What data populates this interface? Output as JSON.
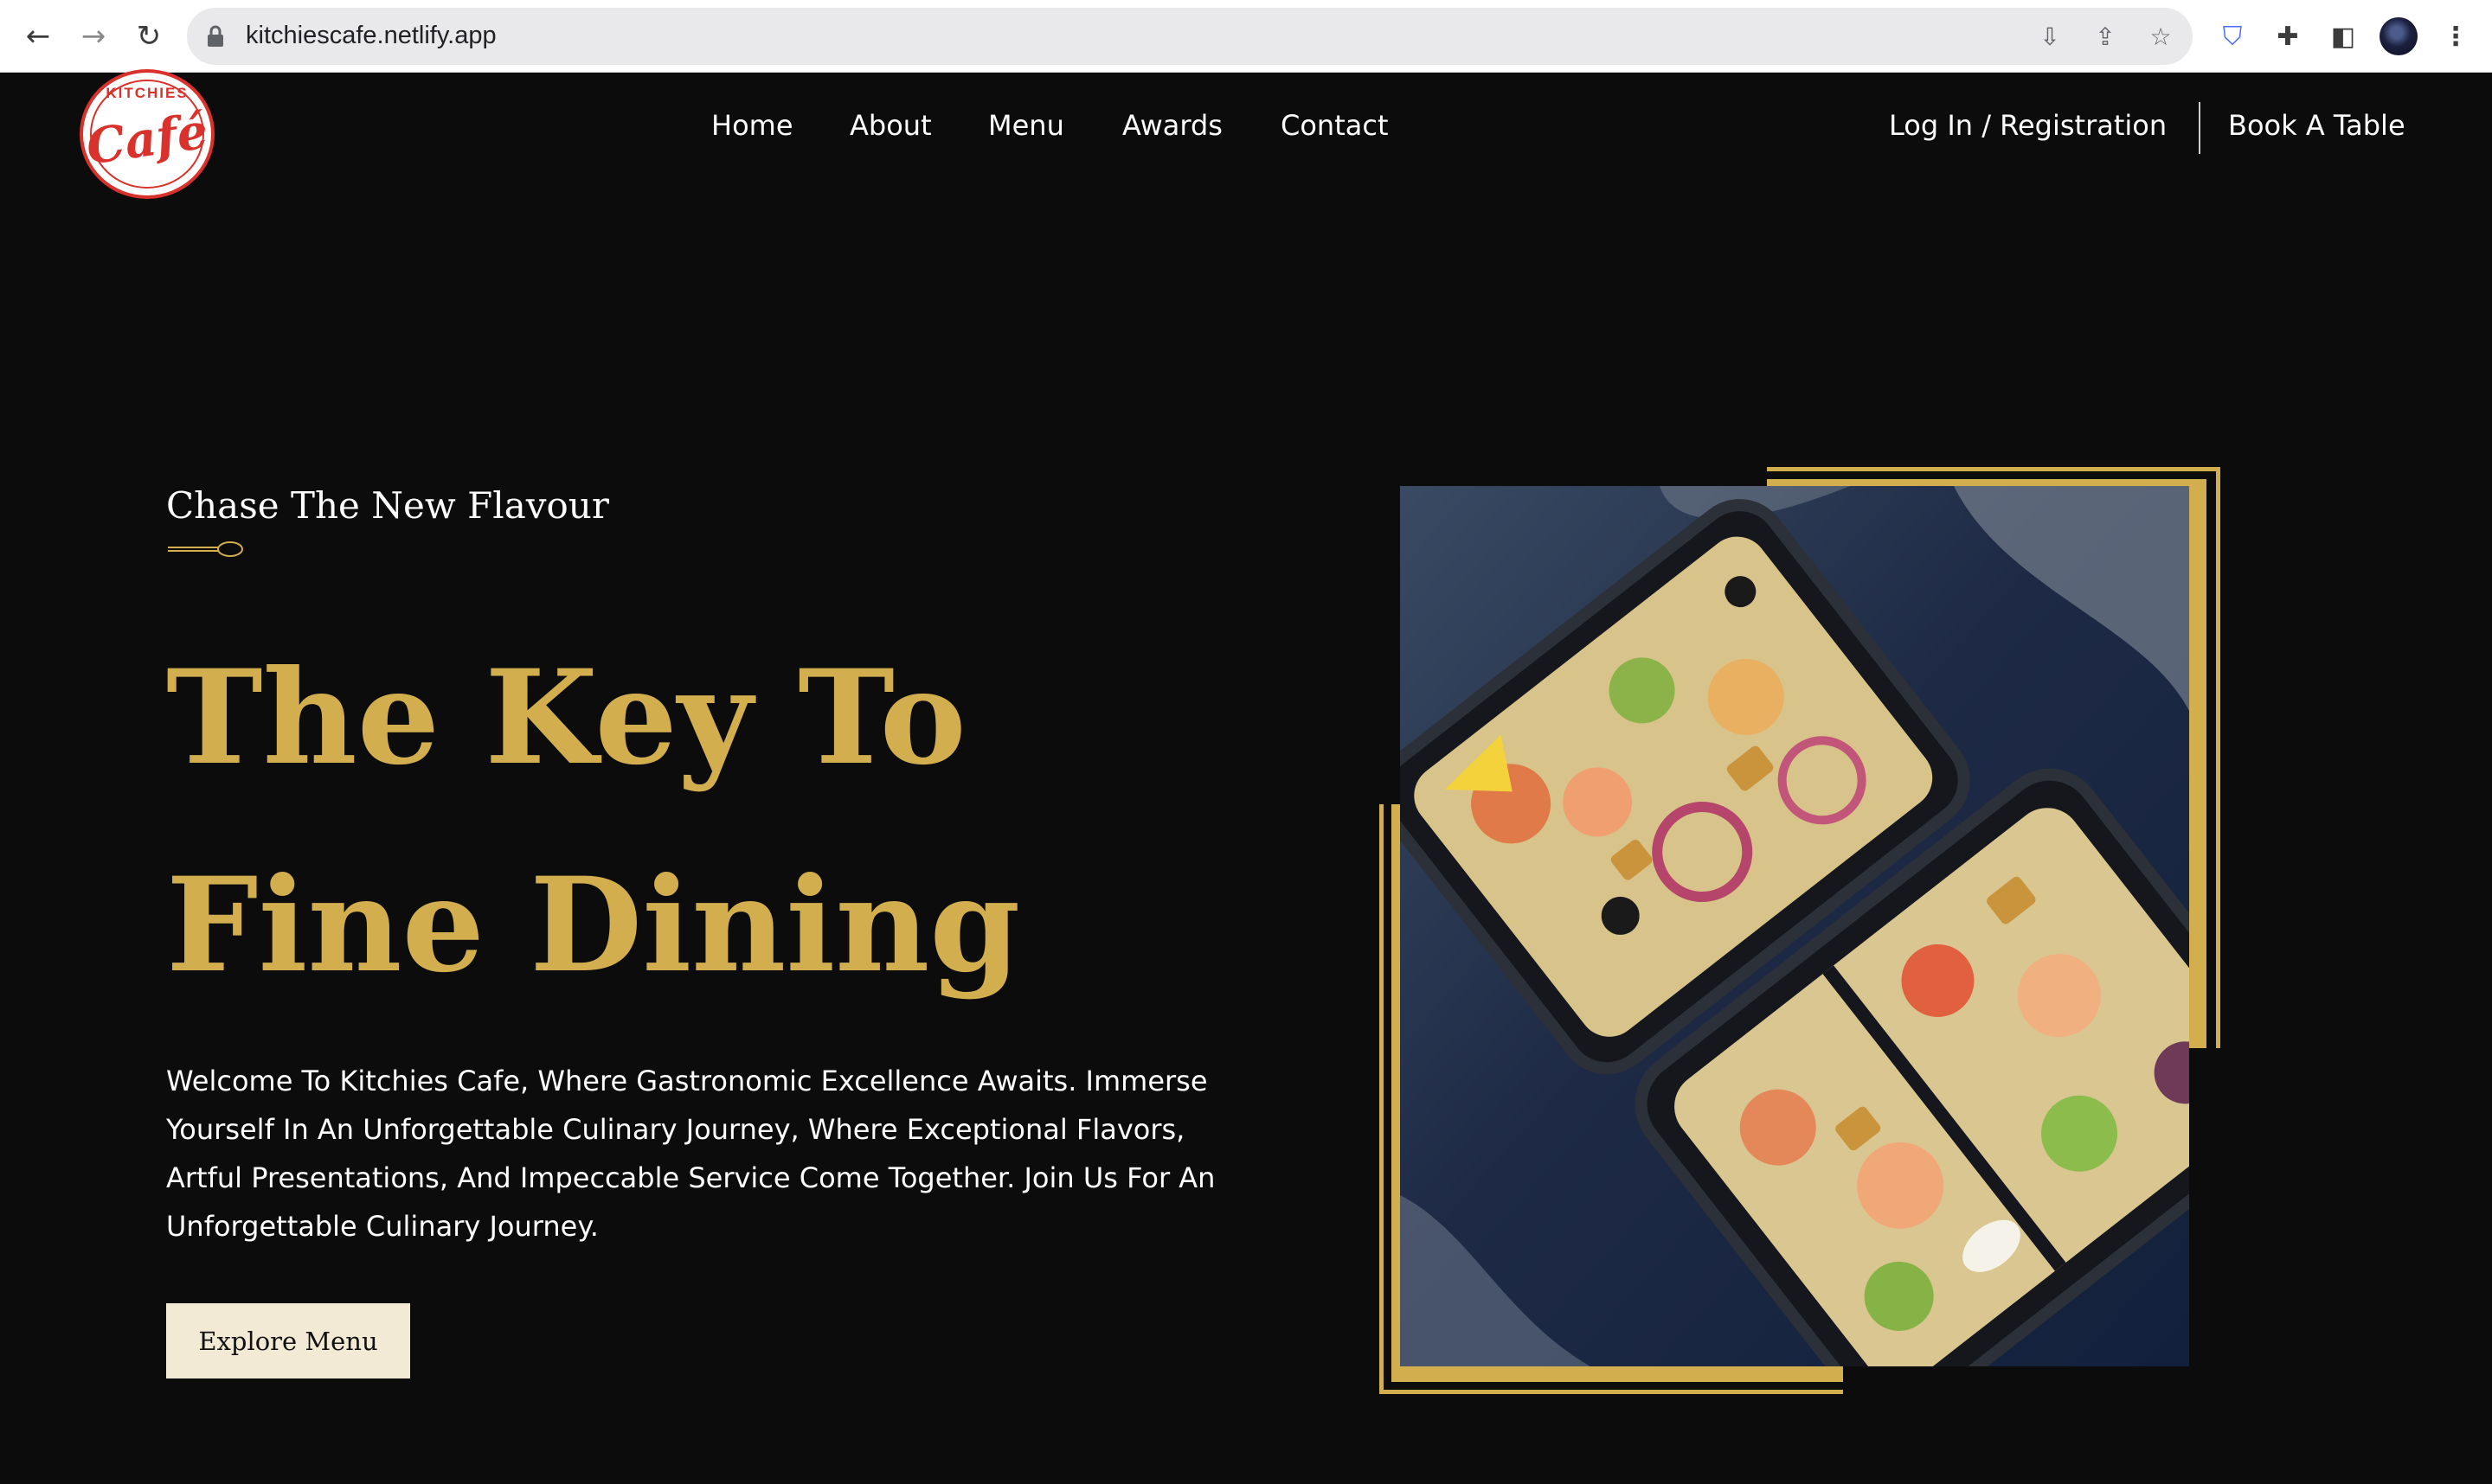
{
  "browser": {
    "url": "kitchiescafe.netlify.app",
    "icons": {
      "back": "back-arrow-icon",
      "forward": "forward-arrow-icon",
      "reload": "reload-icon",
      "lock": "lock-icon",
      "install": "install-app-icon",
      "share": "share-icon",
      "bookmark": "star-icon",
      "extension_shield": "shield-icon",
      "extensions": "puzzle-icon",
      "side_panel": "side-panel-icon",
      "menu": "kebab-menu-icon"
    }
  },
  "site": {
    "logo": {
      "top_text": "KITCHIES",
      "word": "Café"
    },
    "nav": {
      "items": [
        "Home",
        "About",
        "Menu",
        "Awards",
        "Contact"
      ],
      "login": "Log In / Registration",
      "book": "Book A Table"
    },
    "hero": {
      "eyebrow": "Chase The New Flavour",
      "headline_line1": "The Key To",
      "headline_line2": "Fine Dining",
      "lead": "Welcome To Kitchies Cafe, Where Gastronomic Excellence Awaits. Immerse Yourself In An Unforgettable Culinary Journey, Where Exceptional Flavors, Artful Presentations, And Impeccable Service Come Together. Join Us For An Unforgettable Culinary Journey.",
      "cta": "Explore Menu"
    }
  },
  "colors": {
    "background": "#0c0c0c",
    "gold": "#d2ae4f",
    "button_bg": "#f3ead5",
    "logo_red": "#d9312b"
  }
}
